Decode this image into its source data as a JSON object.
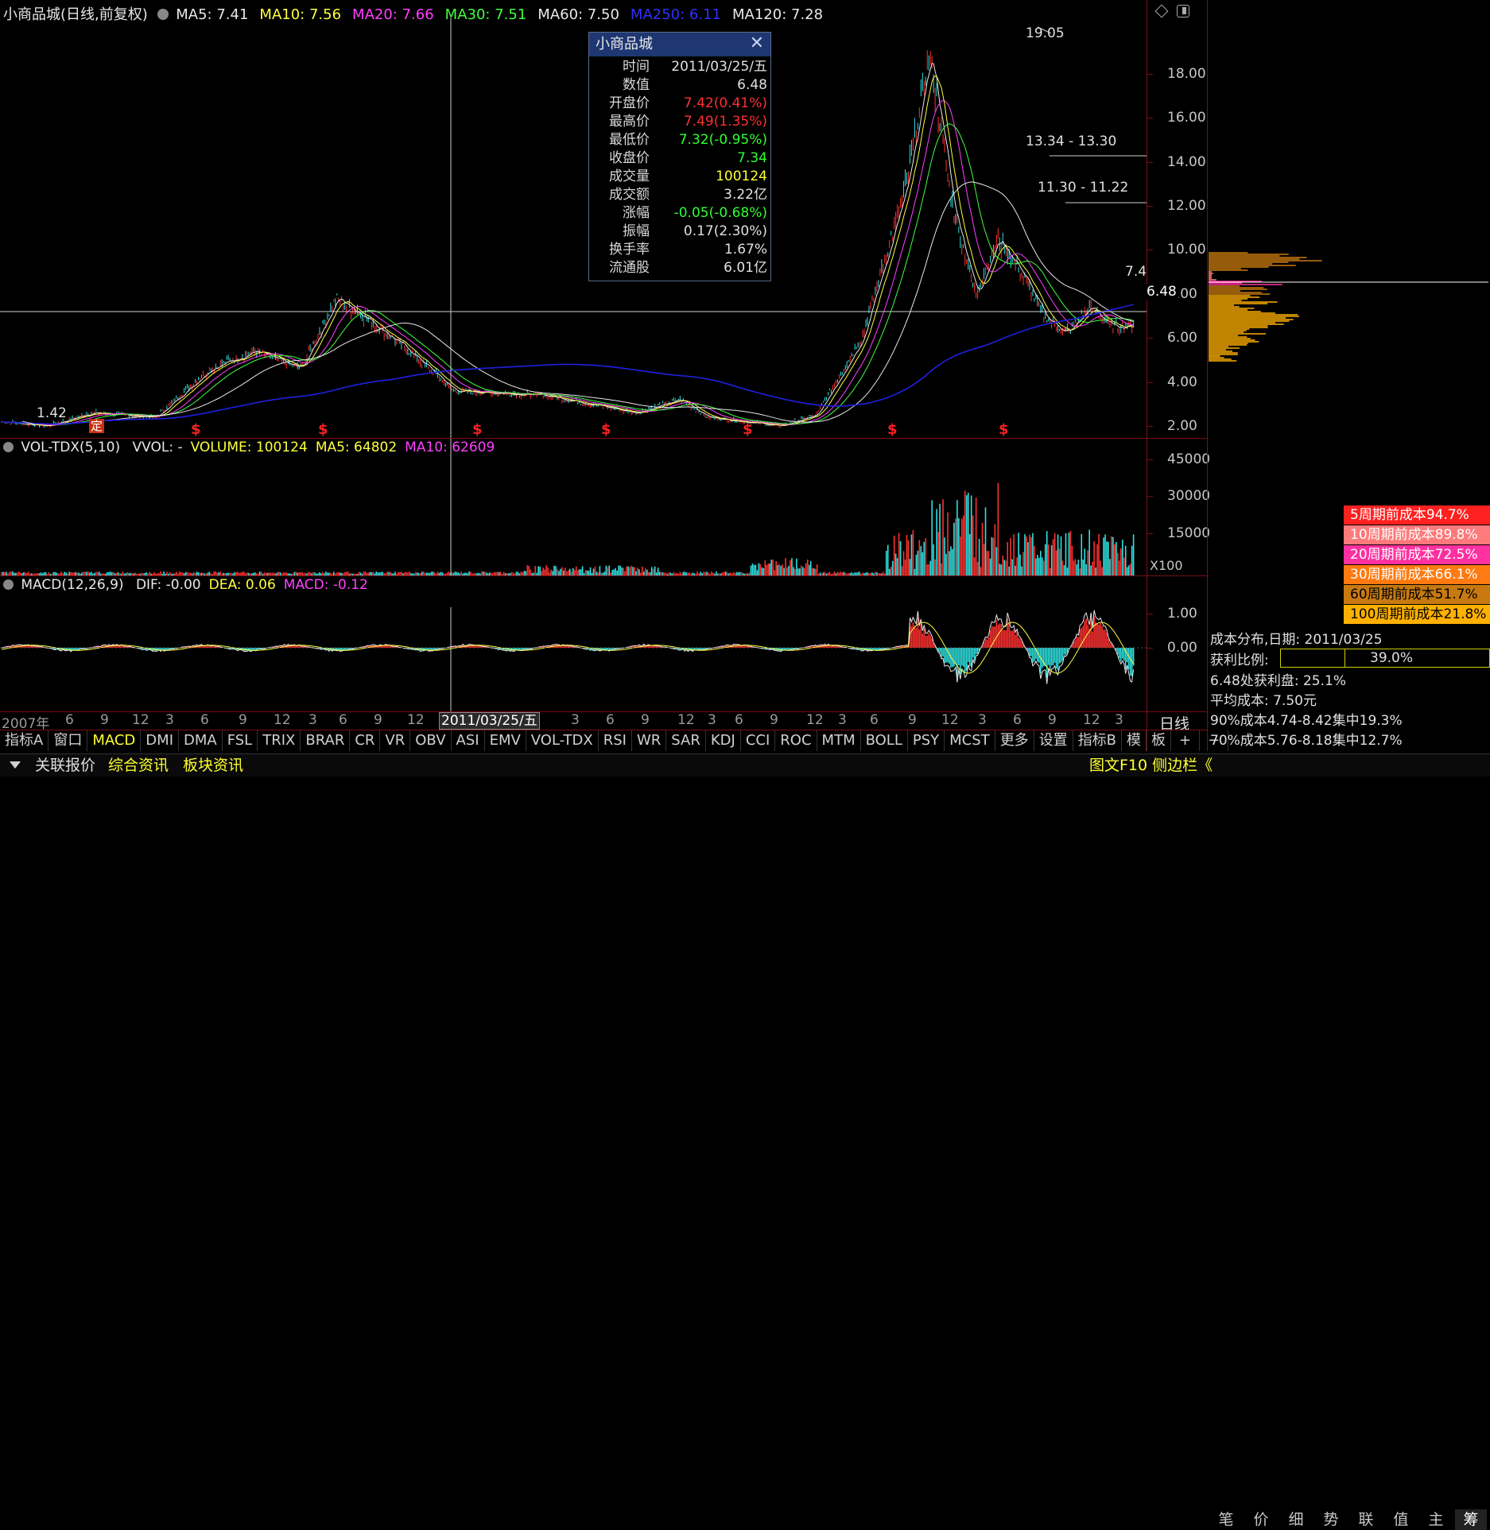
{
  "header": {
    "stock_title": "小商品城(日线,前复权)",
    "ma": [
      {
        "label": "MA5: 7.41",
        "color": "#e8e8e8"
      },
      {
        "label": "MA10: 7.56",
        "color": "#ffff40"
      },
      {
        "label": "MA20: 7.66",
        "color": "#ff40ff"
      },
      {
        "label": "MA30: 7.51",
        "color": "#40ff40"
      },
      {
        "label": "MA60: 7.50",
        "color": "#e8e8e8"
      },
      {
        "label": "MA250: 6.11",
        "color": "#3030ff"
      },
      {
        "label": "MA120: 7.28",
        "color": "#e8e8e8"
      }
    ]
  },
  "price_axis": [
    "18.00",
    "16.00",
    "14.00",
    "12.00",
    "10.00",
    "8.00",
    "6.00",
    "4.00",
    "2.00"
  ],
  "price_marks": {
    "high": "19.05",
    "low": "1.42",
    "cross_value": "6.48",
    "level1": "13.34 - 13.30",
    "level2": "11.30 - 11.22",
    "right_price": "7.4"
  },
  "signal_marks": {
    "ding": "定",
    "dollar": "$"
  },
  "tooltip": {
    "title": "小商品城",
    "close_glyph": "✕",
    "rows": [
      {
        "k": "时间",
        "v": "2011/03/25/五",
        "color": "#e0e0e0"
      },
      {
        "k": "数值",
        "v": "6.48",
        "color": "#e0e0e0"
      },
      {
        "k": "开盘价",
        "v": "7.42(0.41%)",
        "color": "#ff3030"
      },
      {
        "k": "最高价",
        "v": "7.49(1.35%)",
        "color": "#ff3030"
      },
      {
        "k": "最低价",
        "v": "7.32(-0.95%)",
        "color": "#30ff30"
      },
      {
        "k": "收盘价",
        "v": "7.34",
        "color": "#30ff30"
      },
      {
        "k": "成交量",
        "v": "100124",
        "color": "#ffff30"
      },
      {
        "k": "成交额",
        "v": "3.22亿",
        "color": "#e0e0e0"
      },
      {
        "k": "涨幅",
        "v": "-0.05(-0.68%)",
        "color": "#30ff30"
      },
      {
        "k": "振幅",
        "v": "0.17(2.30%)",
        "color": "#e0e0e0"
      },
      {
        "k": "换手率",
        "v": "1.67%",
        "color": "#e0e0e0"
      },
      {
        "k": "流通股",
        "v": "6.01亿",
        "color": "#e0e0e0"
      }
    ]
  },
  "vol_panel": {
    "label": "VOL-TDX(5,10)",
    "items": [
      {
        "label": "VVOL: -",
        "color": "#e8e8e8"
      },
      {
        "label": "VOLUME: 100124",
        "color": "#ffff40"
      },
      {
        "label": "MA5: 64802",
        "color": "#ffff40"
      },
      {
        "label": "MA10: 62609",
        "color": "#ff40ff"
      }
    ],
    "axis": [
      "45000",
      "30000",
      "15000"
    ],
    "unit": "X100"
  },
  "macd_panel": {
    "label": "MACD(12,26,9)",
    "items": [
      {
        "label": "DIF: -0.00",
        "color": "#e8e8e8"
      },
      {
        "label": "DEA: 0.06",
        "color": "#ffff40"
      },
      {
        "label": "MACD: -0.12",
        "color": "#ff40ff"
      }
    ],
    "axis": [
      "1.00",
      "0.00"
    ]
  },
  "x_axis": {
    "labels": [
      "2007年",
      "6",
      "9",
      "12",
      "3",
      "6",
      "9",
      "12",
      "3",
      "6",
      "9",
      "12",
      "3",
      "6",
      "9",
      "12",
      "3",
      "6",
      "9",
      "12",
      "3",
      "6",
      "9",
      "12",
      "3",
      "6",
      "9",
      "12",
      "3",
      "6",
      "9",
      "12",
      "3"
    ],
    "cursor_date": "2011/03/25/五",
    "period": "日线"
  },
  "indicator_tabs": [
    "指标A",
    "窗口",
    "MACD",
    "DMI",
    "DMA",
    "FSL",
    "TRIX",
    "BRAR",
    "CR",
    "VR",
    "OBV",
    "ASI",
    "EMV",
    "VOL-TDX",
    "RSI",
    "WR",
    "SAR",
    "KDJ",
    "CCI",
    "ROC",
    "MTM",
    "BOLL",
    "PSY",
    "MCST",
    "更多",
    "设置"
  ],
  "indicator_right": [
    "指标B",
    "模",
    "板",
    "+",
    "−"
  ],
  "bottom_bar": {
    "links": [
      {
        "label": "关联报价",
        "color": "#e0e0e0"
      },
      {
        "label": "综合资讯",
        "color": "#ffff30"
      },
      {
        "label": "板块资讯",
        "color": "#ffff30"
      }
    ],
    "right_link": "图文F10 侧边栏《",
    "side_tabs": [
      "笔",
      "价",
      "细",
      "势",
      "联",
      "值",
      "主",
      "筹"
    ]
  },
  "cost_legend": [
    {
      "label": "5周期前成本94.7%",
      "color": "#ff2020"
    },
    {
      "label": "10周期前成本89.8%",
      "color": "#ff7a7a"
    },
    {
      "label": "20周期前成本72.5%",
      "color": "#ff30a0"
    },
    {
      "label": "30周期前成本66.1%",
      "color": "#ff7a10"
    },
    {
      "label": "60周期前成本51.7%",
      "color": "#c87a10"
    },
    {
      "label": "100周期前成本21.8%",
      "color": "#ffb000"
    }
  ],
  "cost_info": {
    "date_line": "成本分布,日期: 2011/03/25",
    "profit_label": "获利比例:",
    "profit_value": "39.0%",
    "profit_ratio": 0.39,
    "line3": "6.48处获利盘: 25.1%",
    "line4": "平均成本: 7.50元",
    "line5": "90%成本4.74-8.42集中19.3%",
    "line6": "70%成本5.76-8.18集中12.7%"
  }
}
